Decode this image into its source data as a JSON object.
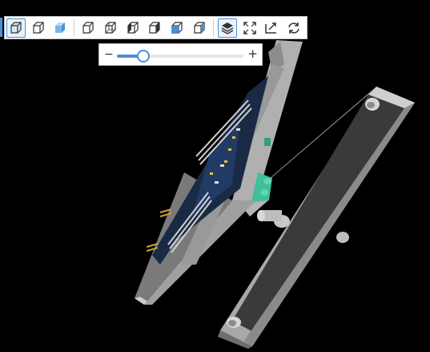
{
  "viewer": {
    "background": "#000000",
    "accent": "#4a90d9"
  },
  "toolbar": {
    "groups": [
      [
        "box-solid-icon",
        "box-wireframe-icon",
        "box-shaded-icon"
      ],
      [
        "view-front-icon",
        "view-back-icon",
        "view-left-icon",
        "view-right-icon",
        "view-top-icon",
        "view-bottom-icon"
      ],
      [
        "layers-icon",
        "fit-screen-icon",
        "explode-icon",
        "rotate-icon"
      ]
    ],
    "active": [
      "box-solid-icon",
      "layers-icon"
    ]
  },
  "zoom_slider": {
    "minus_label": "−",
    "plus_label": "+",
    "level": 0.2
  }
}
